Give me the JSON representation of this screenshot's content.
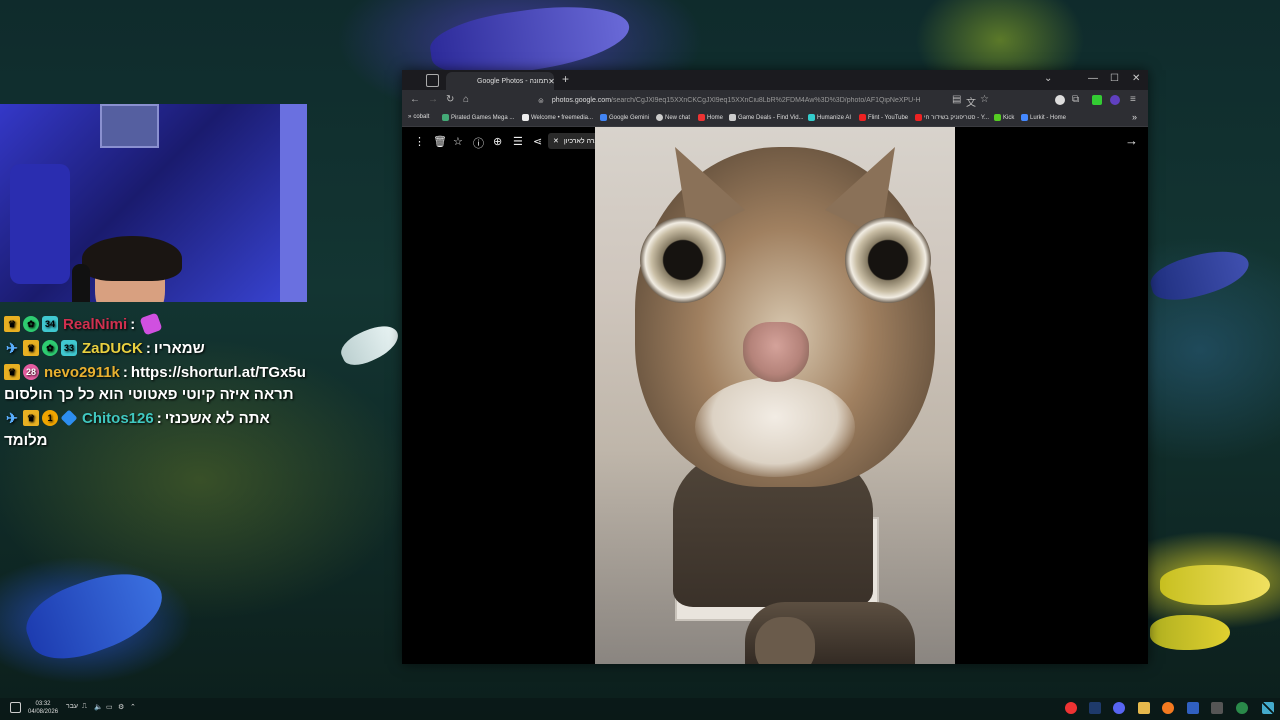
{
  "chat": {
    "messages": [
      {
        "username": "RealNimi",
        "text": "",
        "name_color": "#d0304f",
        "badges": [
          "crown",
          "sub",
          "34"
        ]
      },
      {
        "username": "ZaDUCK",
        "text": "שמאריו",
        "name_color": "#e8d040",
        "badges": [
          "pin",
          "crown",
          "sub",
          "33"
        ]
      },
      {
        "username": "nevo2911k",
        "text": "https://shorturl.at/TGx5u",
        "continuation": "תראה איזה קיוטי פאטוטי הוא כל כך הולסום",
        "name_color": "#e8b030",
        "badges": [
          "crown",
          "28"
        ]
      },
      {
        "username": "Chitos126",
        "text": "אתה לא אשכנזי",
        "continuation": "מלומד",
        "name_color": "#40c8c0",
        "badges": [
          "pin",
          "crown",
          "1",
          "cube"
        ]
      }
    ]
  },
  "browser": {
    "tab_title": "Google Photos - תמונה",
    "url_domain": "photos.google.com",
    "url_path": "/search/CgJXl9eq15XXnCKCgJXl9eq15XXnCiu8LbR%2FDM4Aw%3D%3D/photo/AF1QipNeXPU-Hmf55m8Lex...",
    "bookmarks": [
      {
        "label": "cobalt",
        "color": "#888"
      },
      {
        "label": "Pirated Games Mega ...",
        "color": "#4a7"
      },
      {
        "label": "Welcome • freemedia...",
        "color": "#eee"
      },
      {
        "label": "Google Gemini",
        "color": "#4285f4"
      },
      {
        "label": "New chat",
        "color": "#ccc"
      },
      {
        "label": "Home",
        "color": "#e33"
      },
      {
        "label": "Game Deals - Find Vid...",
        "color": "#ccc"
      },
      {
        "label": "Humanize AI",
        "color": "#3cc"
      },
      {
        "label": "Flint - YouTube",
        "color": "#e22"
      },
      {
        "label": "סטריפוניק בשידור חי - Y...",
        "color": "#e22"
      },
      {
        "label": "Kick",
        "color": "#5c2"
      },
      {
        "label": "Lurkit - Home",
        "color": "#48f"
      }
    ],
    "viewer": {
      "archive_label": "העברה לארכיון"
    }
  },
  "taskbar": {
    "time": "03:32",
    "date": "04/08/2026",
    "lang": "עבר"
  }
}
